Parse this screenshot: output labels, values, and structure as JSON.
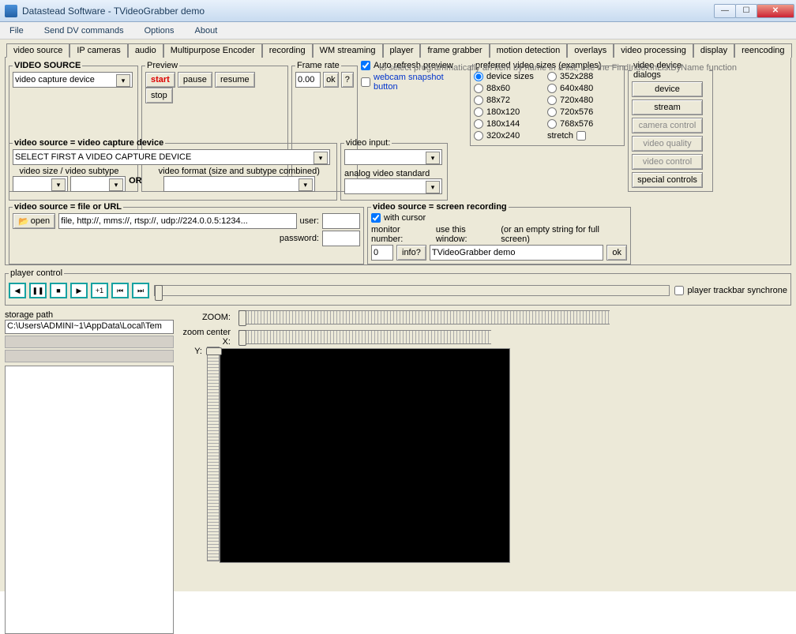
{
  "window": {
    "title": "Datastead Software - TVideoGrabber demo"
  },
  "menu": {
    "file": "File",
    "senddv": "Send DV commands",
    "options": "Options",
    "about": "About"
  },
  "tabs": [
    "video source",
    "IP cameras",
    "audio",
    "Multipurpose Encoder",
    "recording",
    "WM streaming",
    "player",
    "frame grabber",
    "motion detection",
    "overlays",
    "video processing",
    "display",
    "reencoding"
  ],
  "vs": {
    "legend": "VIDEO SOURCE",
    "combo": "video capture device",
    "note": "to select programmatically an item by name in a list, use the FindIndexInListByName function"
  },
  "preview": {
    "legend": "Preview",
    "start": "start",
    "pause": "pause",
    "resume": "resume",
    "stop": "stop"
  },
  "framerate": {
    "legend": "Frame rate",
    "value": "0.00",
    "ok": "ok",
    "huh": "?"
  },
  "autorefresh": "Auto refresh preview",
  "snapshot": "webcam snapshot button",
  "srcdev": {
    "legend": "video source = video capture device",
    "sel": "SELECT FIRST A VIDEO CAPTURE DEVICE",
    "sizeSub": "video size / video subtype",
    "or": "OR",
    "fmt": "video format (size and subtype combined)"
  },
  "vin": {
    "legend": "video input:",
    "analog": "analog video standard"
  },
  "sizes": {
    "legend": "preferred video sizes (examples)",
    "left": [
      "device sizes",
      "88x60",
      "88x72",
      "180x120",
      "180x144",
      "320x240"
    ],
    "right": [
      "352x288",
      "640x480",
      "720x480",
      "720x576",
      "768x576"
    ],
    "stretch": "stretch"
  },
  "dlg": {
    "legend": "video device dialogs",
    "device": "device",
    "stream": "stream",
    "cam": "camera control",
    "vq": "video quality",
    "vc": "video control",
    "sc": "special controls"
  },
  "file": {
    "legend": "video source = file or URL",
    "open": "open",
    "path": "file, http://, mms://, rtsp://, udp://224.0.0.5:1234...",
    "user": "user:",
    "pwd": "password:"
  },
  "scr": {
    "legend": "video source = screen recording",
    "cursor": "with cursor",
    "mon": "monitor number:",
    "win": "use this window:",
    "hint": "(or an empty string for full screen)",
    "monval": "0",
    "info": "info?",
    "use": "TVideoGrabber demo",
    "ok": "ok"
  },
  "player": {
    "legend": "player control",
    "sync": "player trackbar synchrone"
  },
  "storage": {
    "label": "storage path",
    "path": "C:\\Users\\ADMINI~1\\AppData\\Local\\Tem"
  },
  "zoom": {
    "label": "ZOOM:",
    "cx": "zoom center X:",
    "cy": "Y:"
  }
}
